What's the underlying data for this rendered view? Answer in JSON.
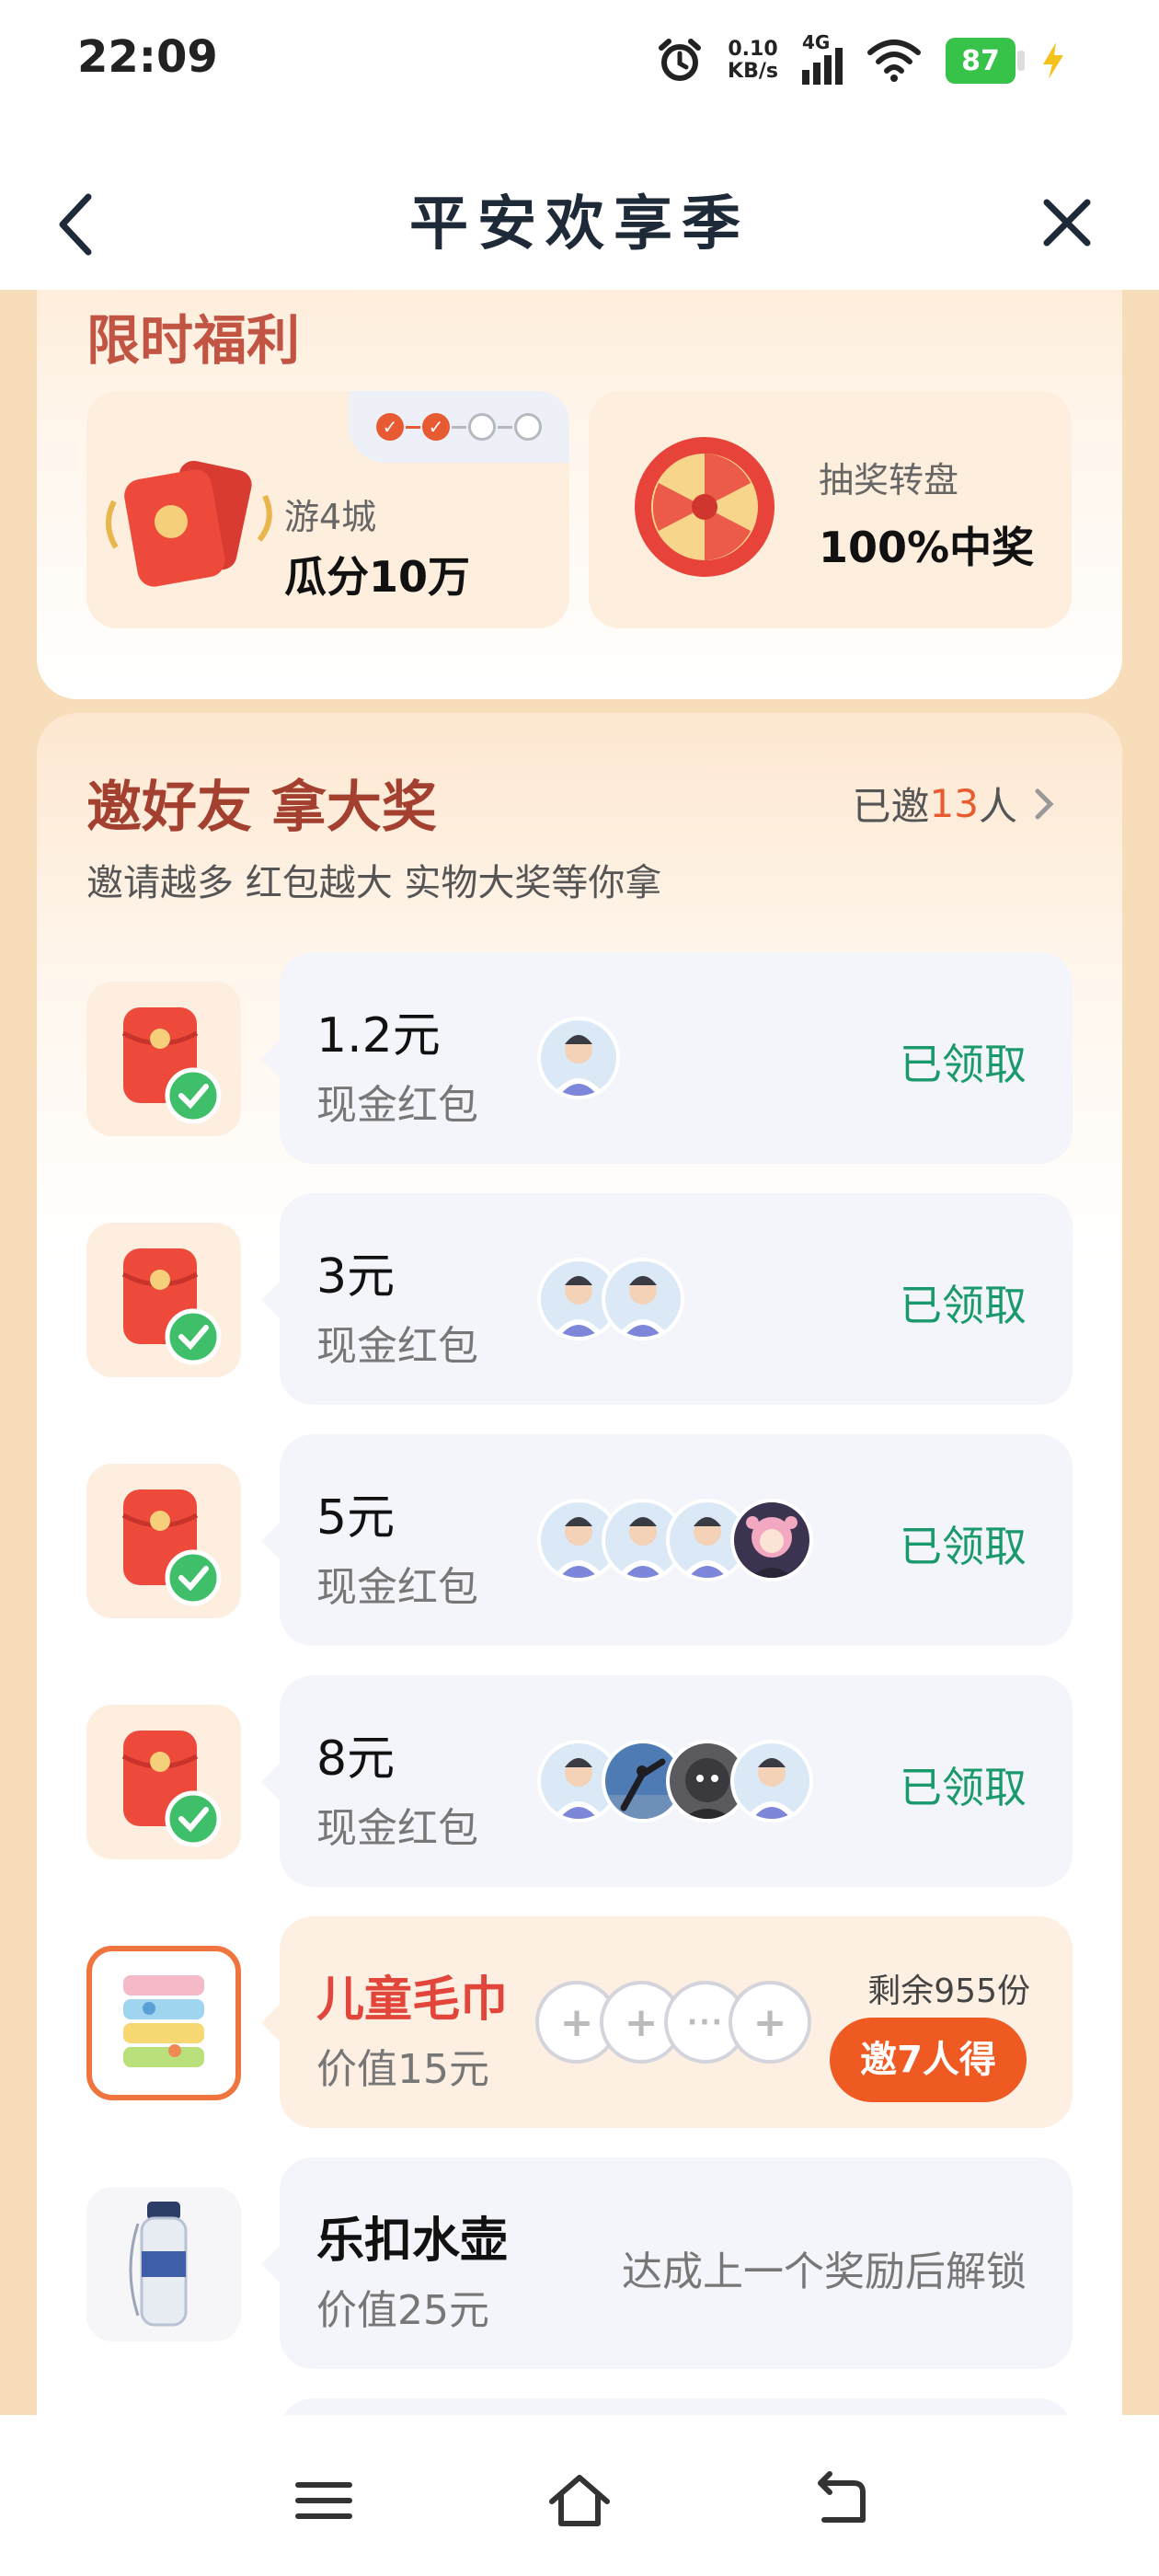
{
  "status_bar": {
    "time": "22:09",
    "net_speed_value": "0.10",
    "net_speed_unit": "KB/s",
    "network": "4G",
    "battery": "87"
  },
  "header": {
    "title": "平安欢享季"
  },
  "welfare": {
    "title": "限时福利",
    "tiles": [
      {
        "label": "游4城",
        "value": "瓜分10万",
        "icon": "red-envelope-icon",
        "progress": {
          "done": 2,
          "total": 4
        }
      },
      {
        "label": "抽奖转盘",
        "value": "100%中奖",
        "icon": "lottery-wheel-icon"
      }
    ]
  },
  "invite": {
    "title": "邀好友 拿大奖",
    "subtitle": "邀请越多 红包越大 实物大奖等你拿",
    "invited_prefix": "已邀",
    "invited_count": "13",
    "invited_suffix": "人",
    "rows": [
      {
        "amount": "1.2元",
        "type": "现金红包",
        "status": "已领取",
        "avatars": 1
      },
      {
        "amount": "3元",
        "type": "现金红包",
        "status": "已领取",
        "avatars": 2
      },
      {
        "amount": "5元",
        "type": "现金红包",
        "status": "已领取",
        "avatars": 4
      },
      {
        "amount": "8元",
        "type": "现金红包",
        "status": "已领取",
        "avatars": 4
      },
      {
        "amount": "儿童毛巾",
        "type": "价值15元",
        "remain": "剩余955份",
        "button": "邀7人得",
        "placeholders": 4
      },
      {
        "amount": "乐扣水壶",
        "type": "价值25元",
        "hint": "达成上一个奖励后解锁"
      }
    ]
  },
  "colors": {
    "accent": "#ef5a22",
    "claimed": "#1a9a6c",
    "background": "#f7ddb9"
  }
}
